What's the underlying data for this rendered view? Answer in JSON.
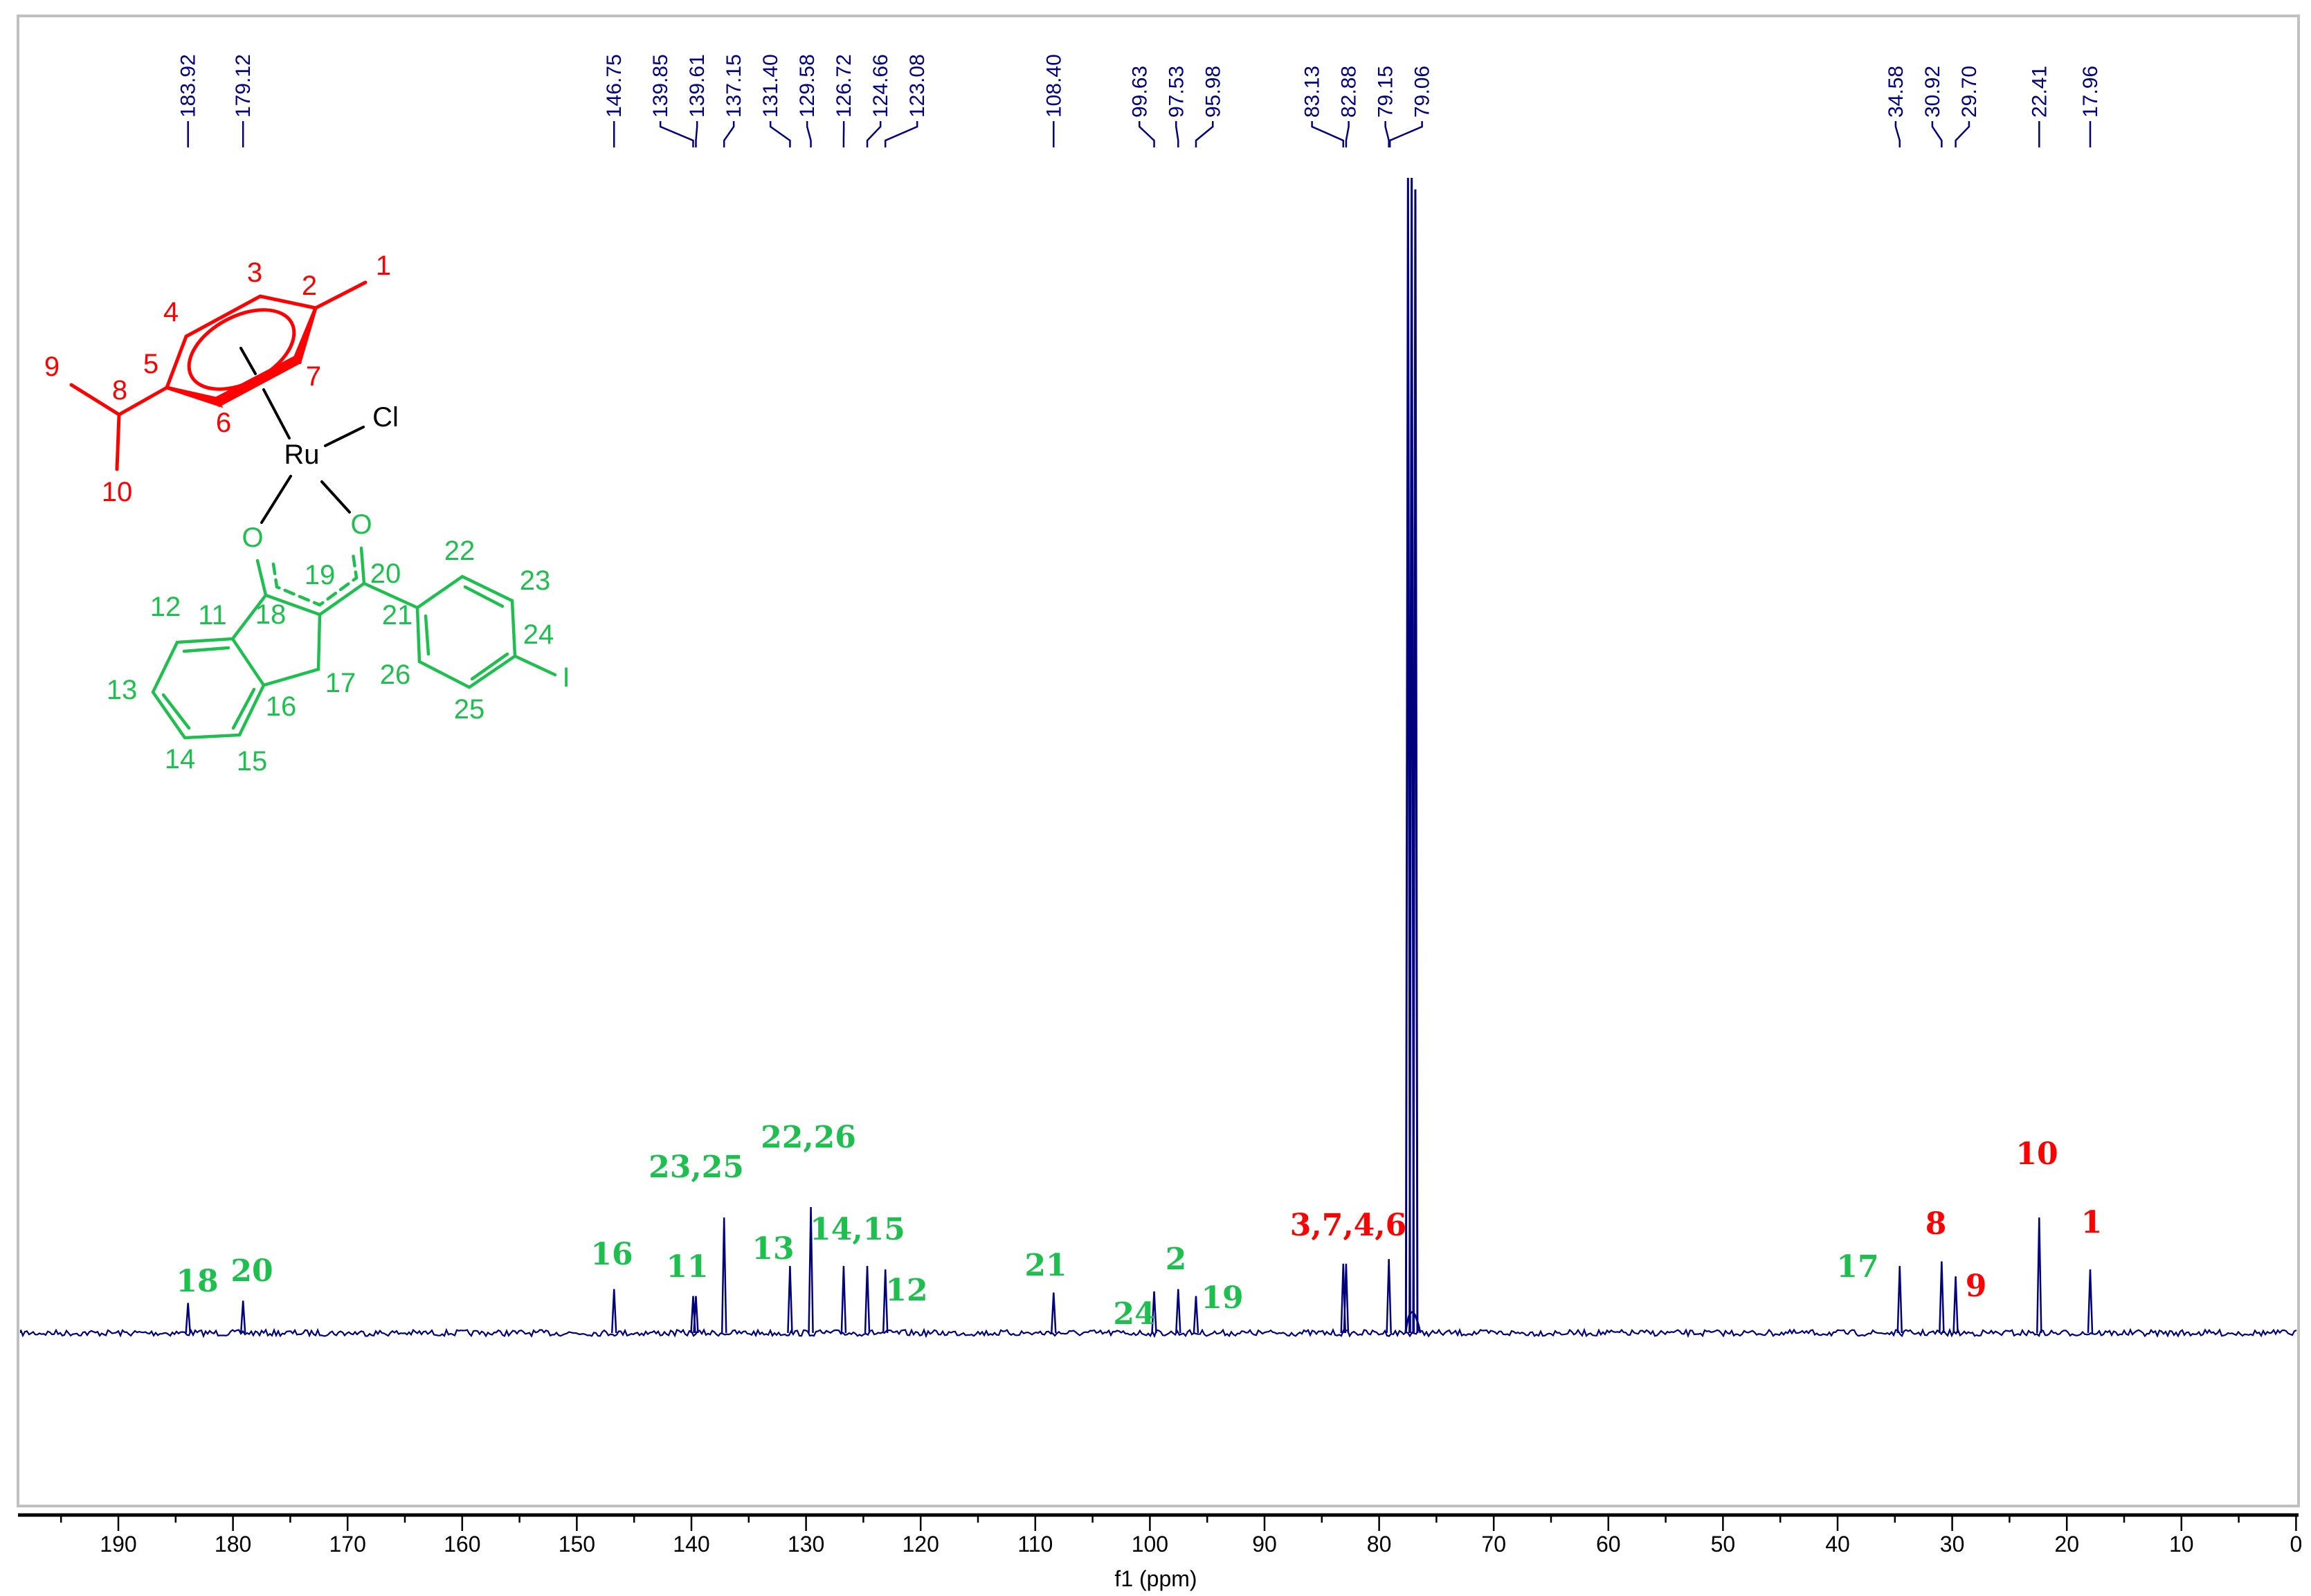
{
  "chart_data": {
    "type": "line",
    "title": "",
    "xlabel": "f1 (ppm)",
    "ylabel": "",
    "xlim": [
      200,
      0
    ],
    "x_ticks": [
      190,
      180,
      170,
      160,
      150,
      140,
      130,
      120,
      110,
      100,
      90,
      80,
      70,
      60,
      50,
      40,
      30,
      20,
      10,
      0
    ],
    "grid": false,
    "colors": {
      "spectrum": "#00007f",
      "cymene": "#ff0000",
      "ligand": "#1fbf4f",
      "metal": "#000000"
    },
    "peak_labels": [
      "183.92",
      "179.12",
      "146.75",
      "139.85",
      "139.61",
      "137.15",
      "131.40",
      "129.58",
      "126.72",
      "124.66",
      "123.08",
      "108.40",
      "99.63",
      "97.53",
      "95.98",
      "83.13",
      "82.88",
      "79.15",
      "79.06",
      "34.58",
      "30.92",
      "29.70",
      "22.41",
      "17.96"
    ],
    "peaks": [
      {
        "ppm": 183.92,
        "intensity": 2.6
      },
      {
        "ppm": 179.12,
        "intensity": 2.8
      },
      {
        "ppm": 146.75,
        "intensity": 3.8
      },
      {
        "ppm": 139.85,
        "intensity": 3.2
      },
      {
        "ppm": 139.61,
        "intensity": 3.2
      },
      {
        "ppm": 137.15,
        "intensity": 10.0
      },
      {
        "ppm": 131.4,
        "intensity": 5.8
      },
      {
        "ppm": 129.58,
        "intensity": 10.9
      },
      {
        "ppm": 126.72,
        "intensity": 5.8
      },
      {
        "ppm": 124.66,
        "intensity": 5.8
      },
      {
        "ppm": 123.08,
        "intensity": 5.5
      },
      {
        "ppm": 108.4,
        "intensity": 3.5
      },
      {
        "ppm": 99.63,
        "intensity": 3.6
      },
      {
        "ppm": 97.53,
        "intensity": 3.8
      },
      {
        "ppm": 95.98,
        "intensity": 3.2
      },
      {
        "ppm": 83.13,
        "intensity": 6.0
      },
      {
        "ppm": 82.88,
        "intensity": 6.0
      },
      {
        "ppm": 79.15,
        "intensity": 6.4
      },
      {
        "ppm": 77.48,
        "intensity": 100
      },
      {
        "ppm": 77.16,
        "intensity": 100
      },
      {
        "ppm": 76.84,
        "intensity": 99
      },
      {
        "ppm": 34.58,
        "intensity": 5.8
      },
      {
        "ppm": 30.92,
        "intensity": 6.2
      },
      {
        "ppm": 29.7,
        "intensity": 4.9
      },
      {
        "ppm": 22.41,
        "intensity": 10.0
      },
      {
        "ppm": 17.96,
        "intensity": 5.5
      }
    ],
    "assignments": [
      {
        "text": "18",
        "ppm": 183.9,
        "group": "ligand"
      },
      {
        "text": "20",
        "ppm": 179.1,
        "group": "ligand"
      },
      {
        "text": "16",
        "ppm": 146.7,
        "group": "ligand"
      },
      {
        "text": "11",
        "ppm": 140.0,
        "group": "ligand"
      },
      {
        "text": "23,25",
        "ppm": 137.2,
        "group": "ligand"
      },
      {
        "text": "13",
        "ppm": 131.4,
        "group": "ligand"
      },
      {
        "text": "22,26",
        "ppm": 129.6,
        "group": "ligand"
      },
      {
        "text": "14,15",
        "ppm": 125.5,
        "group": "ligand"
      },
      {
        "text": "12",
        "ppm": 123.1,
        "group": "ligand"
      },
      {
        "text": "21",
        "ppm": 108.4,
        "group": "ligand"
      },
      {
        "text": "24",
        "ppm": 99.6,
        "group": "ligand"
      },
      {
        "text": "2",
        "ppm": 97.5,
        "group": "ligand"
      },
      {
        "text": "19",
        "ppm": 96.0,
        "group": "ligand"
      },
      {
        "text": "3,7,4,6",
        "ppm": 83.0,
        "group": "cymene"
      },
      {
        "text": "17",
        "ppm": 34.6,
        "group": "ligand"
      },
      {
        "text": "8",
        "ppm": 30.9,
        "group": "cymene"
      },
      {
        "text": "9",
        "ppm": 29.7,
        "group": "cymene"
      },
      {
        "text": "10",
        "ppm": 22.4,
        "group": "cymene"
      },
      {
        "text": "1",
        "ppm": 18.0,
        "group": "cymene"
      }
    ]
  },
  "structure": {
    "metal": "Ru",
    "chloride": "Cl",
    "oxygen": "O",
    "iodine": "I",
    "cymene_numbers": [
      "1",
      "2",
      "3",
      "4",
      "5",
      "6",
      "7",
      "8",
      "9",
      "10"
    ],
    "ligand_numbers": [
      "11",
      "12",
      "13",
      "14",
      "15",
      "16",
      "17",
      "18",
      "19",
      "20",
      "21",
      "22",
      "23",
      "24",
      "25",
      "26"
    ]
  }
}
